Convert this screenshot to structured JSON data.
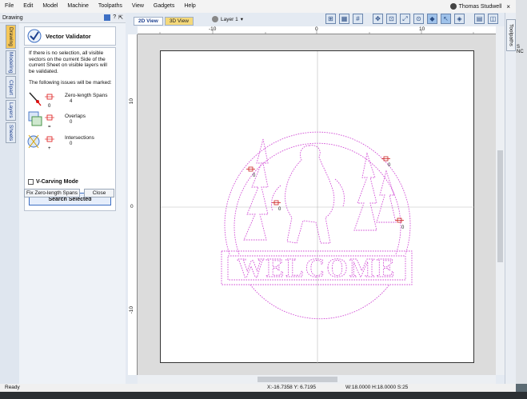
{
  "menubar": {
    "items": [
      "File",
      "Edit",
      "Model",
      "Machine",
      "Toolpaths",
      "View",
      "Gadgets",
      "Help"
    ],
    "user_name": "Thomas Studwell",
    "window_close": "×"
  },
  "panel": {
    "header": "Drawing",
    "header_icons": [
      "?",
      "⇱"
    ],
    "side_tabs": [
      "Drawing",
      "Modeling",
      "Clipart",
      "Layers",
      "Sheets"
    ],
    "title": "Vector Validator",
    "description": "If there is no selection, all visible vectors on the current Side of the current Sheet on visible layers will be validated.",
    "issues_label": "The following issues will be marked:",
    "issues": [
      {
        "label": "Zero-length Spans",
        "count": "4",
        "marker": "0"
      },
      {
        "label": "Overlaps",
        "count": "0",
        "marker": "="
      },
      {
        "label": "Intersections",
        "count": "0",
        "marker": "+"
      }
    ],
    "vcarve_label": "V-Carving Mode",
    "search_button": "Search Selected",
    "fix_button": "Fix Zero-length Spans",
    "close_button": "Close"
  },
  "view": {
    "tabs": [
      "2D View",
      "3D View"
    ],
    "layer": "Layer 1",
    "right_tab": "Toolpaths",
    "right_strip_text": "S NC"
  },
  "rulers": {
    "h_labels": [
      "-10",
      "0",
      "10"
    ],
    "v_labels": [
      "10",
      "0",
      "-10"
    ]
  },
  "drawing": {
    "text": "WELCOME",
    "markers": [
      "0",
      "0",
      "0",
      "0"
    ]
  },
  "status": {
    "ready": "Ready",
    "coords": "X:-16.7358 Y:  6.7195",
    "dims": "W:18.0000   H:18.0000  S:25"
  },
  "colors": {
    "vector": "#d24fd6",
    "sheet_border": "#333333",
    "accent": "#3d6fc4"
  }
}
